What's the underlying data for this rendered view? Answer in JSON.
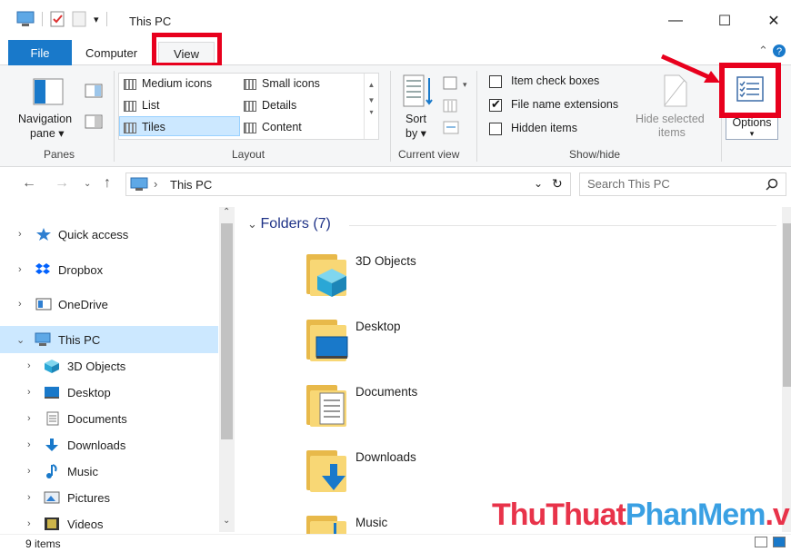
{
  "window": {
    "title": "This PC",
    "controls": {
      "minimize": "—",
      "maximize": "☐",
      "close": "✕"
    }
  },
  "tabs": [
    {
      "label": "File"
    },
    {
      "label": "Computer"
    },
    {
      "label": "View"
    }
  ],
  "ribbon": {
    "panes": {
      "navigation_label_1": "Navigation",
      "navigation_label_2": "pane ▾",
      "group": "Panes"
    },
    "layout": {
      "items": [
        "Medium icons",
        "Small icons",
        "List",
        "Details",
        "Tiles",
        "Content"
      ],
      "selected": "Tiles",
      "group": "Layout"
    },
    "current_view": {
      "sort_label_1": "Sort",
      "sort_label_2": "by ▾",
      "group": "Current view"
    },
    "show_hide": {
      "item_check_boxes": {
        "label": "Item check boxes",
        "checked": false
      },
      "file_name_extensions": {
        "label": "File name extensions",
        "checked": true
      },
      "hidden_items": {
        "label": "Hidden items",
        "checked": false
      },
      "hide_selected_1": "Hide selected",
      "hide_selected_2": "items",
      "group": "Show/hide"
    },
    "options": {
      "label": "Options",
      "caret": "▾"
    }
  },
  "address": {
    "path": "This PC",
    "separator": "›",
    "search_placeholder": "Search This PC"
  },
  "nav_pane": {
    "items": [
      {
        "label": "Quick access",
        "icon": "star-icon"
      },
      {
        "label": "Dropbox",
        "icon": "dropbox-icon"
      },
      {
        "label": "OneDrive",
        "icon": "onedrive-icon"
      },
      {
        "label": "This PC",
        "icon": "computer-icon",
        "selected": true
      },
      {
        "label": "3D Objects",
        "icon": "cube-icon"
      },
      {
        "label": "Desktop",
        "icon": "desktop-icon"
      },
      {
        "label": "Documents",
        "icon": "document-icon"
      },
      {
        "label": "Downloads",
        "icon": "download-icon"
      },
      {
        "label": "Music",
        "icon": "music-icon"
      },
      {
        "label": "Pictures",
        "icon": "pictures-icon"
      },
      {
        "label": "Videos",
        "icon": "videos-icon"
      }
    ]
  },
  "content": {
    "group_header": "Folders (7)",
    "folders": [
      "3D Objects",
      "Desktop",
      "Documents",
      "Downloads",
      "Music"
    ]
  },
  "status": {
    "items": "9 items"
  },
  "watermark": {
    "part1": "ThuThuat",
    "part2": "PhanMem",
    "part3": ".vn"
  },
  "colors": {
    "accent": "#1979ca",
    "highlight": "#e8001d",
    "selection": "#cce8ff"
  }
}
